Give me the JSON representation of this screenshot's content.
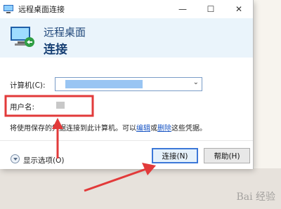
{
  "window": {
    "title": "远程桌面连接"
  },
  "header": {
    "title": "远程桌面",
    "subtitle": "连接"
  },
  "form": {
    "computer_label": "计算机(C):",
    "username_label": "用户名:",
    "info_prefix": "将使用保存的凭据连接到此计算机。可以",
    "edit_link": "编辑",
    "or_text": "或",
    "delete_link": "删除",
    "info_suffix": "这些凭据。"
  },
  "footer": {
    "show_options": "显示选项(O)",
    "connect_button": "连接(N)",
    "help_button": "帮助(H)"
  },
  "watermark": "Bai 经验",
  "colors": {
    "accent": "#3c78d8",
    "annotation": "#e23a3a",
    "header_bg": "#eaf4fb"
  }
}
